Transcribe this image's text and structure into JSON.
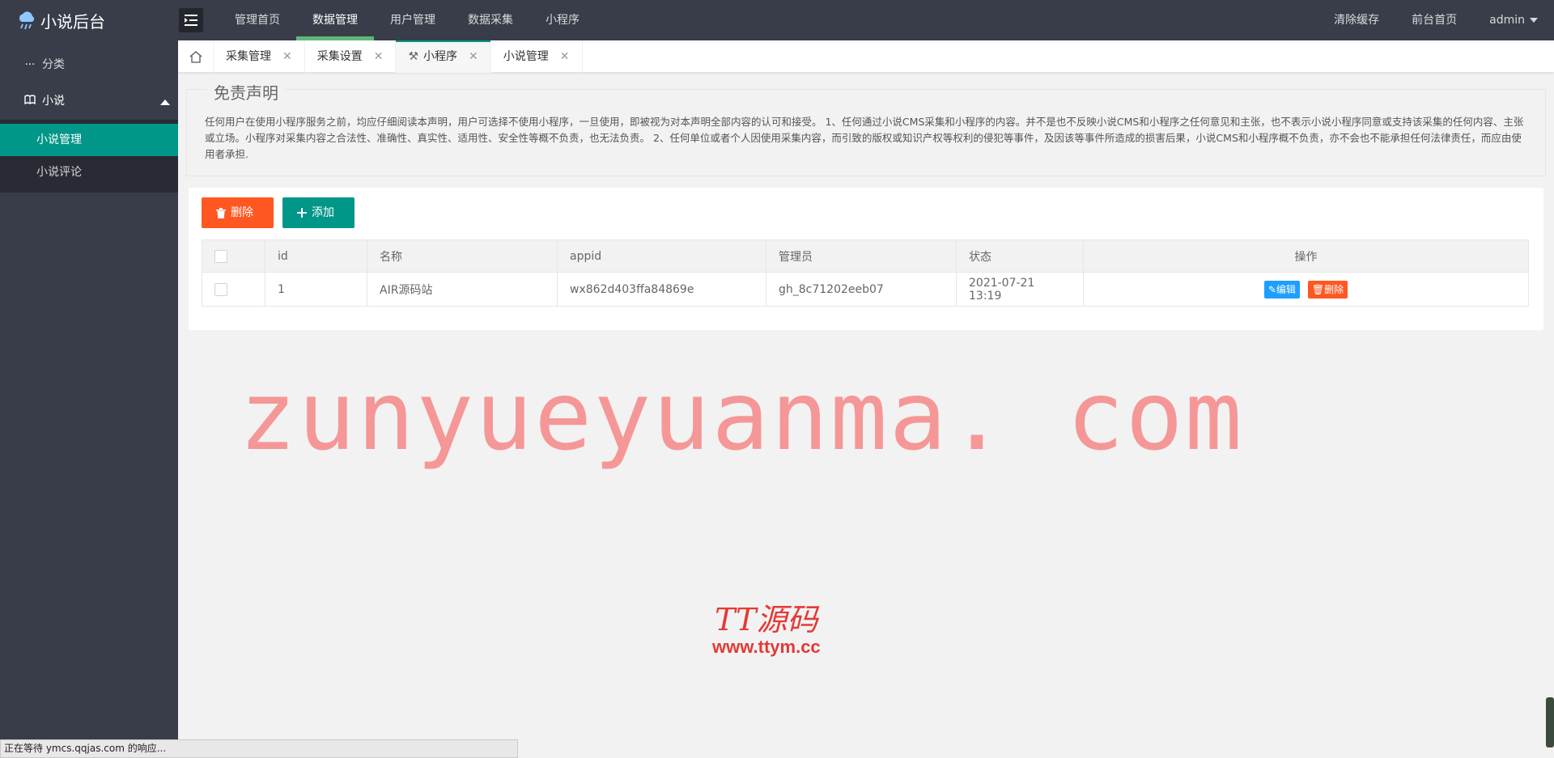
{
  "app": {
    "title": "小说后台"
  },
  "topnav": {
    "items": [
      {
        "label": "管理首页"
      },
      {
        "label": "数据管理"
      },
      {
        "label": "用户管理"
      },
      {
        "label": "数据采集"
      },
      {
        "label": "小程序"
      }
    ],
    "right": {
      "clear_cache": "清除缓存",
      "frontend_home": "前台首页",
      "user": "admin"
    }
  },
  "sidebar": {
    "category": "分类",
    "novel": "小说",
    "sub": [
      {
        "label": "小说管理"
      },
      {
        "label": "小说评论"
      }
    ]
  },
  "tabs": [
    {
      "label": "采集管理"
    },
    {
      "label": "采集设置"
    },
    {
      "label": "小程序"
    },
    {
      "label": "小说管理"
    }
  ],
  "disclaimer": {
    "title": "免责声明",
    "text": "任何用户在使用小程序服务之前，均应仔细阅读本声明，用户可选择不使用小程序，一旦使用，即被视为对本声明全部内容的认可和接受。 1、任何通过小说CMS采集和小程序的内容。并不是也不反映小说CMS和小程序之任何意见和主张，也不表示小说小程序同意或支持该采集的任何内容、主张或立场。小程序对采集内容之合法性、准确性、真实性、适用性、安全性等概不负责，也无法负责。 2、任何单位或者个人因使用采集内容，而引致的版权或知识产权等权利的侵犯等事件，及因该等事件所造成的损害后果，小说CMS和小程序概不负责，亦不会也不能承担任何法律责任，而应由使用者承担."
  },
  "toolbar": {
    "delete_label": "删除",
    "add_label": "添加"
  },
  "table": {
    "columns": [
      "id",
      "名称",
      "appid",
      "管理员",
      "状态",
      "操作"
    ],
    "rows": [
      {
        "id": "1",
        "name": "AIR源码站",
        "appid": "wx862d403ffa84869e",
        "admin": "gh_8c71202eeb07",
        "status": "2021-07-21 13:19"
      }
    ],
    "edit_label": "编辑",
    "delete_label": "删除"
  },
  "watermarks": {
    "main": "zunyueyuanma. com",
    "logo_top": "TT源码",
    "logo_bottom": "www.ttym.cc"
  },
  "statusbar": {
    "text": "正在等待 ymcs.qqjas.com 的响应..."
  },
  "colors": {
    "header": "#393d49",
    "accent": "#009688",
    "danger": "#ff5722",
    "info": "#1e9fff",
    "active_nav": "#5fb878"
  }
}
